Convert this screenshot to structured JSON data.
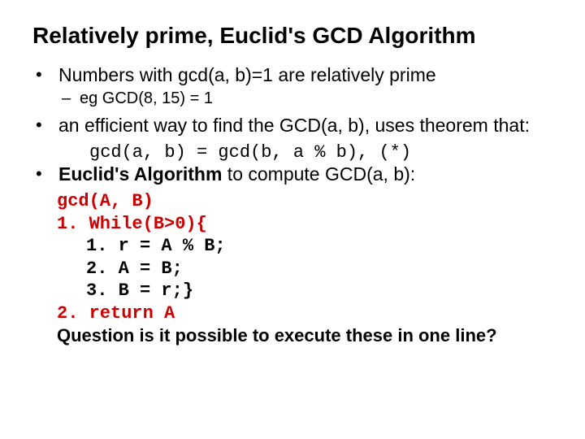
{
  "title": "Relatively prime, Euclid's GCD Algorithm",
  "bullets": {
    "b1": "Numbers with gcd(a, b)=1 are relatively prime",
    "b1_sub": "eg GCD(8, 15) = 1",
    "b2": "an efficient way to find the GCD(a, b), uses theorem that:",
    "theorem": "gcd(a, b) = gcd(b, a % b), (*)",
    "b3_prefix": "Euclid's Algorithm",
    "b3_rest": " to compute GCD(a, b):"
  },
  "code": {
    "sig": "gcd(A, B)",
    "l1": "1. While(B>0){",
    "i1": "1. r = A % B;",
    "i2": "2. A = B;",
    "i3": "3. B = r;}",
    "l2": "2. return A",
    "question": "Question is it possible to execute these in one line?"
  }
}
